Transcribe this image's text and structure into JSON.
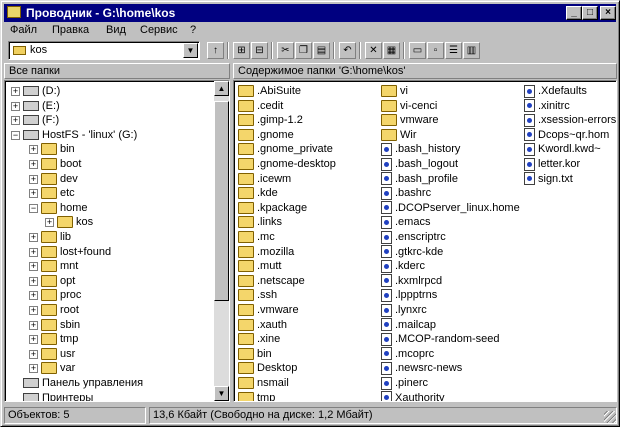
{
  "window": {
    "title": "Проводник - G:\\home\\kos",
    "min": "_",
    "max": "□",
    "close": "×"
  },
  "menu": [
    "Файл",
    "Правка",
    "Вид",
    "Сервис",
    "?"
  ],
  "address": {
    "value": "kos",
    "dropdown": "▼"
  },
  "headers": {
    "left": "Все папки",
    "right": "Содержимое папки 'G:\\home\\kos'"
  },
  "tree": [
    {
      "label": "(D:)",
      "icon": "drive-icon",
      "pm": "+"
    },
    {
      "label": "(E:)",
      "icon": "cdrom-icon",
      "pm": "+"
    },
    {
      "label": "(F:)",
      "icon": "drive-icon",
      "pm": "+"
    },
    {
      "label": "HostFS - 'linux' (G:)",
      "icon": "network-drive-icon",
      "pm": "−"
    },
    {
      "label": "bin",
      "icon": "folder-icon",
      "pm": "+"
    },
    {
      "label": "boot",
      "icon": "folder-icon",
      "pm": "+"
    },
    {
      "label": "dev",
      "icon": "folder-icon",
      "pm": "+"
    },
    {
      "label": "etc",
      "icon": "folder-icon",
      "pm": "+"
    },
    {
      "label": "home",
      "icon": "folder-icon",
      "pm": "−"
    },
    {
      "label": "kos",
      "icon": "folder-open-icon",
      "pm": "+"
    },
    {
      "label": "lib",
      "icon": "folder-icon",
      "pm": "+"
    },
    {
      "label": "lost+found",
      "icon": "folder-icon",
      "pm": "+"
    },
    {
      "label": "mnt",
      "icon": "folder-icon",
      "pm": "+"
    },
    {
      "label": "opt",
      "icon": "folder-icon",
      "pm": "+"
    },
    {
      "label": "proc",
      "icon": "folder-icon",
      "pm": "+"
    },
    {
      "label": "root",
      "icon": "folder-icon",
      "pm": "+"
    },
    {
      "label": "sbin",
      "icon": "folder-icon",
      "pm": "+"
    },
    {
      "label": "tmp",
      "icon": "folder-icon",
      "pm": "+"
    },
    {
      "label": "usr",
      "icon": "folder-icon",
      "pm": "+"
    },
    {
      "label": "var",
      "icon": "folder-icon",
      "pm": "+"
    },
    {
      "label": "Панель управления",
      "icon": "control-panel-icon",
      "pm": ""
    },
    {
      "label": "Принтеры",
      "icon": "printer-icon",
      "pm": ""
    }
  ],
  "files_col1": [
    ".AbiSuite",
    ".cedit",
    ".gimp-1.2",
    ".gnome",
    ".gnome_private",
    ".gnome-desktop",
    ".icewm",
    ".kde",
    ".kpackage",
    ".links",
    ".mc",
    ".mozilla",
    ".mutt",
    ".netscape",
    ".ssh",
    ".vmware",
    ".xauth",
    ".xine",
    "bin",
    "Desktop",
    "nsmail",
    "tmp"
  ],
  "files_col2": [
    "vi",
    "vi-cenci",
    "vmware",
    "Wir",
    ".bash_history",
    ".bash_logout",
    ".bash_profile",
    ".bashrc",
    ".DCOPserver_linux.home",
    ".emacs",
    ".enscriptrc",
    ".gtkrc-kde",
    ".kderc",
    ".kxmlrpcd",
    ".lppptrns",
    ".lynxrc",
    ".mailcap",
    ".MCOP-random-seed",
    ".mcoprc",
    ".newsrc-news",
    ".pinerc",
    "Xauthority"
  ],
  "files_col2_folders": [
    true,
    true,
    true,
    true,
    false,
    false,
    false,
    false,
    false,
    false,
    false,
    false,
    false,
    false,
    false,
    false,
    false,
    false,
    false,
    false,
    false,
    false
  ],
  "files_col3": [
    ".Xdefaults",
    ".xinitrc",
    ".xsession-errors",
    "Dcops~qr.hom",
    "Kwordl.kwd~",
    "letter.kor",
    "sign.txt"
  ],
  "status": {
    "objects": "Объектов: 5",
    "size": "13,6 Кбайт (Свободно на диске: 1,2 Мбайт)"
  }
}
